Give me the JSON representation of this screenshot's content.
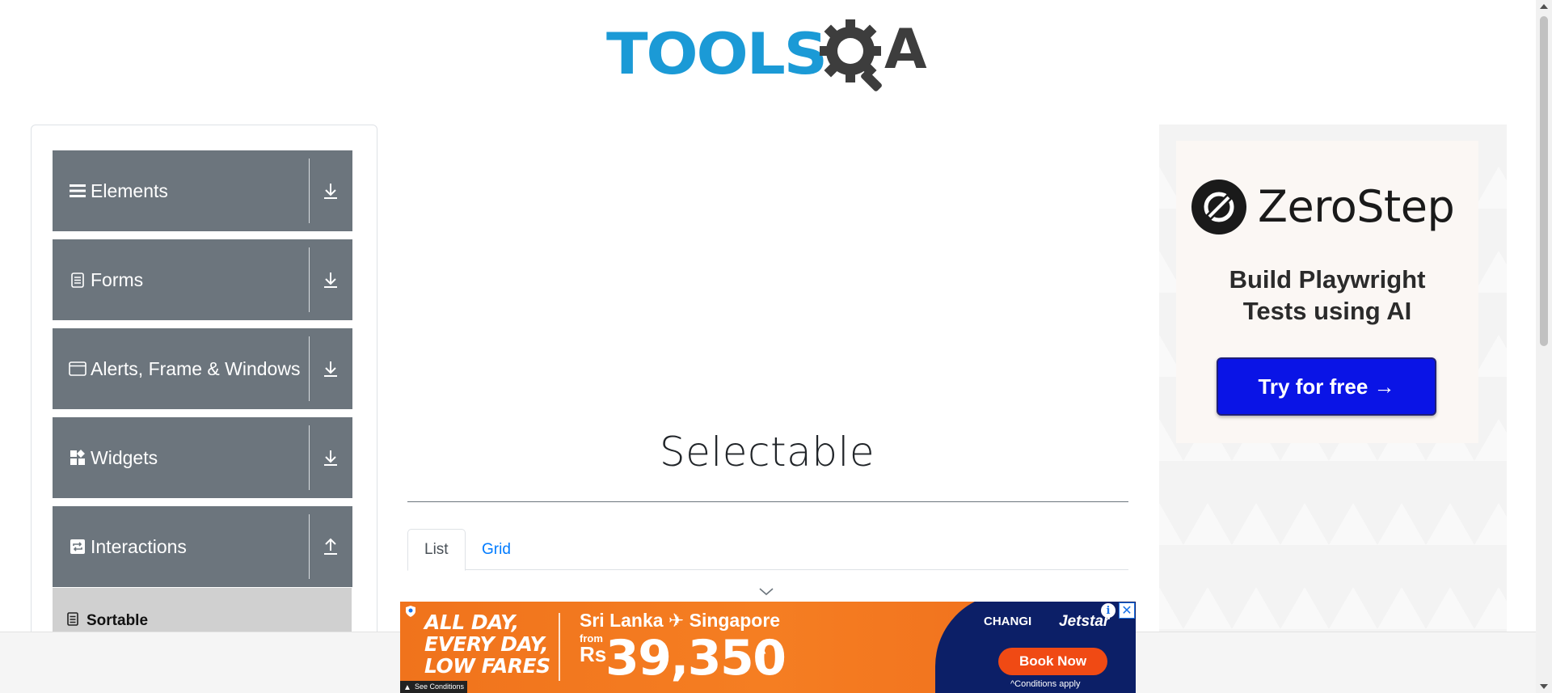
{
  "header": {
    "logo_text": "TOOLS",
    "logo_letter": "A"
  },
  "sidebar": {
    "groups": [
      {
        "label": "Elements",
        "icon": "hamburger-icon",
        "arrow": "download-icon"
      },
      {
        "label": "Forms",
        "icon": "document-icon",
        "arrow": "download-icon"
      },
      {
        "label": "Alerts, Frame & Windows",
        "icon": "window-icon",
        "arrow": "download-icon"
      },
      {
        "label": "Widgets",
        "icon": "widgets-icon",
        "arrow": "download-icon"
      },
      {
        "label": "Interactions",
        "icon": "interactions-icon",
        "arrow": "upload-icon"
      }
    ],
    "sub_items": [
      {
        "label": "Sortable",
        "icon": "archive-icon"
      }
    ]
  },
  "main": {
    "title": "Selectable",
    "tabs": [
      {
        "label": "List",
        "active": true
      },
      {
        "label": "Grid",
        "active": false
      }
    ]
  },
  "right_ad": {
    "brand": "ZeroStep",
    "tagline_line1": "Build Playwright",
    "tagline_line2": "Tests using AI",
    "cta": "Try for free →",
    "button_color": "#0a14e6"
  },
  "bottom_ad": {
    "line1": "ALL DAY,",
    "line2": "EVERY DAY,",
    "line3": "LOW FARES",
    "route": "Sri Lanka ✈ Singapore",
    "from": "from",
    "currency": "Rs",
    "price": "39,350",
    "caret": "^",
    "partner1": "CHANGI",
    "partner2": "Jetstar",
    "cta": "Book Now",
    "conditions": "^Conditions apply",
    "see_conditions": "See Conditions",
    "close": "✕",
    "info": "i"
  },
  "colors": {
    "brand_blue": "#1b9ad6",
    "sidebar_gray": "#6c757d",
    "link_blue": "#007bff"
  }
}
